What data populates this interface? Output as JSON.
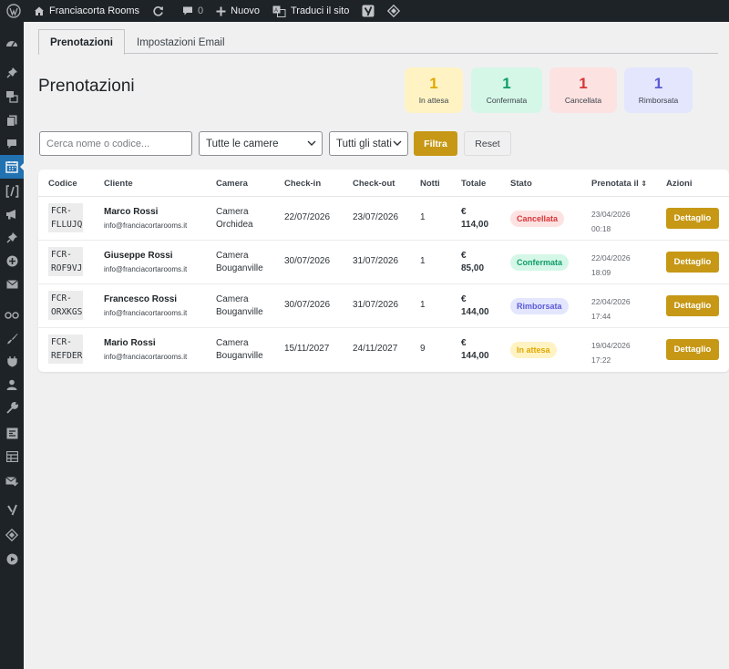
{
  "adminbar": {
    "site_name": "Franciacorta Rooms",
    "comments_count": "0",
    "new_label": "Nuovo",
    "translate_label": "Traduci il sito",
    "icons": [
      "wordpress-icon",
      "home-icon",
      "updates-icon",
      "comments-icon",
      "plus-icon",
      "translate-icon",
      "yoast-icon",
      "diamond-icon"
    ]
  },
  "sidebar": {
    "icons": [
      "dashboard-icon",
      "pin-icon",
      "media-icon",
      "pages-icon",
      "comments-icon",
      "calendar-icon",
      "shortcode-icon",
      "megaphone-icon",
      "pin-icon",
      "plus-circle-icon",
      "mail-icon",
      "loop-icon",
      "brush-icon",
      "plugins-icon",
      "users-icon",
      "tools-icon",
      "settings-icon",
      "table-icon",
      "mail-check-icon",
      "yoast-icon",
      "diamond-icon",
      "play-icon"
    ],
    "active_icon": "calendar-icon"
  },
  "tabs": [
    {
      "label": "Prenotazioni",
      "active": true
    },
    {
      "label": "Impostazioni Email",
      "active": false
    }
  ],
  "page_title": "Prenotazioni",
  "stats": [
    {
      "count": "1",
      "label": "In attesa",
      "color": "#e0a800",
      "bg": "#fff3c4"
    },
    {
      "count": "1",
      "label": "Confermata",
      "color": "#0f9d6a",
      "bg": "#d5f7e8"
    },
    {
      "count": "1",
      "label": "Cancellata",
      "color": "#d63638",
      "bg": "#fde2e2"
    },
    {
      "count": "1",
      "label": "Rimborsata",
      "color": "#5b5bd6",
      "bg": "#e3e6fd"
    }
  ],
  "filters": {
    "search_placeholder": "Cerca nome o codice...",
    "room_select": "Tutte le camere",
    "status_select": "Tutti gli stati",
    "filter_button": "Filtra",
    "reset_button": "Reset"
  },
  "table": {
    "headers": [
      "Codice",
      "Cliente",
      "Camera",
      "Check-in",
      "Check-out",
      "Notti",
      "Totale",
      "Stato",
      "Prenotata il",
      "Azioni"
    ],
    "sort_indicator": "⇕",
    "action_label": "Dettaglio",
    "rows": [
      {
        "code1": "FCR-",
        "code2": "FLLUJQ",
        "name": "Marco Rossi",
        "email": "info@franciacortarooms.it",
        "room1": "Camera",
        "room2": "Orchidea",
        "checkin": "22/07/2026",
        "checkout": "23/07/2026",
        "nights": "1",
        "total1": "€",
        "total2": "114,00",
        "status": "Cancellata",
        "status_color": "#d63638",
        "status_bg": "#fde2e2",
        "date": "23/04/2026",
        "time": "00:18"
      },
      {
        "code1": "FCR-",
        "code2": "ROF9VJ",
        "name": "Giuseppe Rossi",
        "email": "info@franciacortarooms.it",
        "room1": "Camera",
        "room2": "Bouganville",
        "checkin": "30/07/2026",
        "checkout": "31/07/2026",
        "nights": "1",
        "total1": "€",
        "total2": "85,00",
        "status": "Confermata",
        "status_color": "#0f9d6a",
        "status_bg": "#d5f7e8",
        "date": "22/04/2026",
        "time": "18:09"
      },
      {
        "code1": "FCR-",
        "code2": "ORXKGS",
        "name": "Francesco Rossi",
        "email": "info@franciacortarooms.it",
        "room1": "Camera",
        "room2": "Bouganville",
        "checkin": "30/07/2026",
        "checkout": "31/07/2026",
        "nights": "1",
        "total1": "€",
        "total2": "144,00",
        "status": "Rimborsata",
        "status_color": "#5b5bd6",
        "status_bg": "#e3e6fd",
        "date": "22/04/2026",
        "time": "17:44"
      },
      {
        "code1": "FCR-",
        "code2": "REFDER",
        "name": "Mario Rossi",
        "email": "info@franciacortarooms.it",
        "room1": "Camera",
        "room2": "Bouganville",
        "checkin": "15/11/2027",
        "checkout": "24/11/2027",
        "nights": "9",
        "total1": "€",
        "total2": "144,00",
        "status": "In attesa",
        "status_color": "#e0a800",
        "status_bg": "#fff3c4",
        "date": "19/04/2026",
        "time": "17:22"
      }
    ]
  },
  "colors": {
    "accent": "#c69816",
    "admin_bar": "#1d2327",
    "active_menu": "#2271b1"
  }
}
